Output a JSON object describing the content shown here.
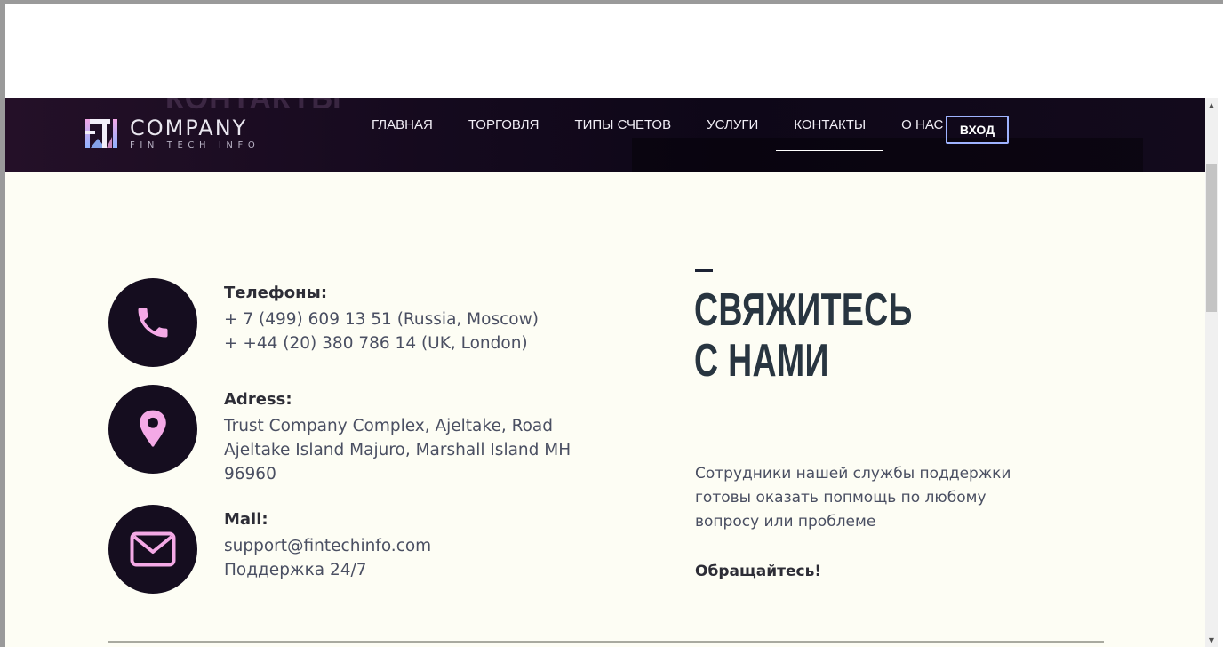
{
  "header": {
    "ghost_text": "КОНТАКТЫ",
    "logo": {
      "main": "COMPANY",
      "sub": "FIN TECH INFO"
    },
    "nav": [
      {
        "label": "ГЛАВНАЯ"
      },
      {
        "label": "ТОРГОВЛЯ"
      },
      {
        "label": "ТИПЫ СЧЕТОВ"
      },
      {
        "label": "УСЛУГИ"
      },
      {
        "label": "КОНТАКТЫ",
        "active": true
      },
      {
        "label": "О НАС"
      }
    ],
    "login": "ВХОД"
  },
  "contacts": {
    "phones": {
      "label": "Телефоны:",
      "lines": [
        "+ 7 (499) 609 13 51 (Russia, Moscow)",
        "+ +44 (20) 380 786 14 (UK, London)"
      ],
      "icon": "phone-icon"
    },
    "address": {
      "label": "Adress:",
      "lines": [
        "Trust Company Complex, Ajeltake, Road",
        "Ajeltake Island Majuro, Marshall Island MH",
        "96960"
      ],
      "icon": "map-pin-icon"
    },
    "mail": {
      "label": "Mail:",
      "lines": [
        "support@fintechinfo.com",
        "Поддержка 24/7"
      ],
      "icon": "envelope-icon"
    }
  },
  "side": {
    "title_line1": "СВЯЖИТЕСЬ",
    "title_line2": "С НАМИ",
    "description": "Сотрудники нашей службы поддержки готовы оказать попмощь по любому вопросу или проблеме",
    "cta": "Обращайтесь!"
  },
  "colors": {
    "header_bg": "#150a1e",
    "content_bg": "#fdfdf4",
    "icon_circle": "#150d1f",
    "icon_color": "#f4a9e6",
    "login_border": "#9fb3ff"
  }
}
